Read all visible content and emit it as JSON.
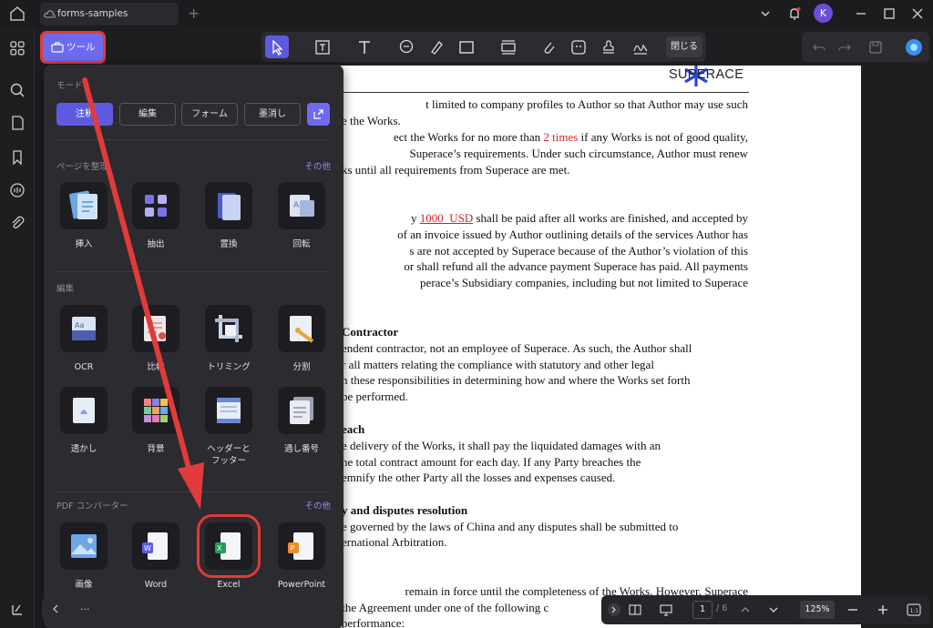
{
  "window": {
    "tab_title": "forms-samples",
    "avatar_initial": "K"
  },
  "toolbar": {
    "tools_label": "ツール",
    "close_label": "閉じる"
  },
  "popup": {
    "mode_title": "モード",
    "modes": [
      "注釈",
      "編集",
      "フォーム",
      "墨消し"
    ],
    "page_section_title": "ページを整理",
    "page_more": "その他",
    "page_tools": [
      "挿入",
      "抽出",
      "置換",
      "回転"
    ],
    "edit_section_title": "編集",
    "edit_tools": [
      "OCR",
      "比較",
      "トリミング",
      "分割",
      "透かし",
      "背景",
      "ヘッダーと\nフッター",
      "通し番号"
    ],
    "converter_section_title": "PDF コンバーター",
    "converter_more": "その他",
    "converter_tools": [
      "画像",
      "Word",
      "Excel",
      "PowerPoint"
    ]
  },
  "document": {
    "logo": "SUPERACE",
    "l1": "t limited to company profiles to Author so that Author may use such",
    "l2": "e the Works.",
    "l3a": "ect the Works for no more than ",
    "l3b": "2 times",
    "l3c": " if any Works is not of good quality,",
    "l4": "Superace’s requirements. Under such circumstance, Author must renew",
    "l5": "ks until all requirements from Superace are met.",
    "l6a": "y ",
    "l6b": "1000_USD",
    "l6c": " shall be paid after all works are finished, and accepted by",
    "l7": "of an invoice issued by Author outlining details of the services Author has",
    "l8": "s are not accepted by Superace because of the Author’s violation of this",
    "l9": "or shall refund all the advance payment Superace has paid. All payments",
    "l10": "perace’s Subsidiary companies, including but not limited to Superace",
    "h1": "Contractor",
    "l11": "endent contractor, not an employee of Superace. As such, the Author shall",
    "l12": "r all matters relating the compliance with statutory and other legal",
    "l13": "n these responsibilities in determining how and where the Works set forth",
    "l14": "be performed.",
    "h2": "each",
    "l15": "e delivery of the Works, it shall pay the liquidated damages with an",
    "l16": "he total contract amount for each day. If any Party breaches the",
    "l17": "emnify the other Party all the losses and expenses caused.",
    "h3": "y and disputes resolution",
    "l18": "e governed by the laws of China and any disputes shall be submitted to",
    "l19": "ernational Arbitration.",
    "l20": "remain in force until the completeness of the Works. However, Superace",
    "l21": "has the right to terminate the Agreement under one of the following c",
    "l22": "1) For inadequate or non-performance:"
  },
  "bottom": {
    "page_current": "1",
    "page_total": "/ 6",
    "zoom": "125%",
    "left_dots": "..."
  },
  "colors": {
    "accent": "#6e6af0",
    "highlight": "#e23a3a"
  }
}
